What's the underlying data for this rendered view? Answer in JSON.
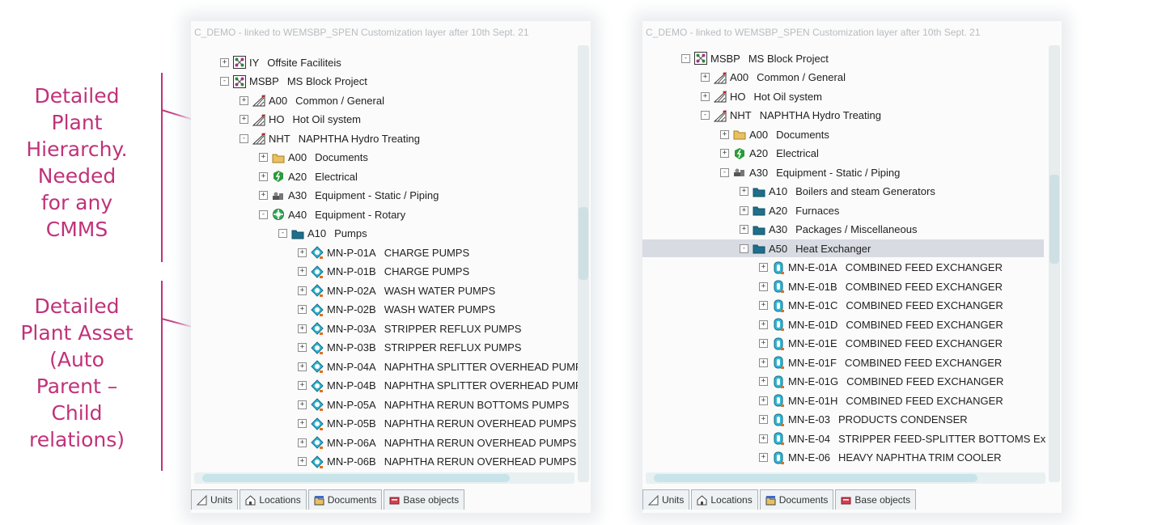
{
  "annotations": {
    "top": [
      "Detailed",
      "Plant",
      "Hierarchy.",
      "Needed",
      "for any",
      "CMMS"
    ],
    "bottom": [
      "Detailed",
      "Plant Asset",
      "(Auto",
      "Parent –",
      "Child",
      "relations)"
    ]
  },
  "colors": {
    "annotation": "#c0327a",
    "folder": "#1f6f8b",
    "pump": "#2fb8d8",
    "selected": "#d9dbe3"
  },
  "left_panel": {
    "header": "C_DEMO - linked to WEMSBP_SPEN  Customization layer after 10th Sept. 21",
    "rows": [
      {
        "exp": "+",
        "icon": "project-icon",
        "code": "IY",
        "name": "Offsite Faciliteis"
      },
      {
        "exp": "-",
        "icon": "project-icon",
        "code": "MSBP",
        "name": "MS Block Project"
      },
      {
        "exp": "+",
        "icon": "unit-icon",
        "code": "A00",
        "name": "Common / General"
      },
      {
        "exp": "+",
        "icon": "unit-icon",
        "code": "HO",
        "name": "Hot Oil system"
      },
      {
        "exp": "-",
        "icon": "unit-icon",
        "code": "NHT",
        "name": "NAPHTHA Hydro Treating"
      },
      {
        "exp": "+",
        "icon": "documents-folder-icon",
        "code": "A00",
        "name": "Documents"
      },
      {
        "exp": "+",
        "icon": "electrical-icon",
        "code": "A20",
        "name": "Electrical"
      },
      {
        "exp": "+",
        "icon": "static-equipment-icon",
        "code": "A30",
        "name": "Equipment - Static / Piping"
      },
      {
        "exp": "-",
        "icon": "rotary-equipment-icon",
        "code": "A40",
        "name": "Equipment - Rotary"
      },
      {
        "exp": "-",
        "icon": "folder-icon",
        "code": "A10",
        "name": "Pumps"
      },
      {
        "exp": "+",
        "icon": "pump-icon",
        "code": "MN-P-01A",
        "name": "CHARGE PUMPS"
      },
      {
        "exp": "+",
        "icon": "pump-icon",
        "code": "MN-P-01B",
        "name": "CHARGE PUMPS"
      },
      {
        "exp": "+",
        "icon": "pump-icon",
        "code": "MN-P-02A",
        "name": "WASH WATER PUMPS"
      },
      {
        "exp": "+",
        "icon": "pump-icon",
        "code": "MN-P-02B",
        "name": "WASH WATER PUMPS"
      },
      {
        "exp": "+",
        "icon": "pump-icon",
        "code": "MN-P-03A",
        "name": "STRIPPER REFLUX PUMPS"
      },
      {
        "exp": "+",
        "icon": "pump-icon",
        "code": "MN-P-03B",
        "name": "STRIPPER REFLUX PUMPS"
      },
      {
        "exp": "+",
        "icon": "pump-icon",
        "code": "MN-P-04A",
        "name": "NAPHTHA SPLITTER OVERHEAD PUMP"
      },
      {
        "exp": "+",
        "icon": "pump-icon",
        "code": "MN-P-04B",
        "name": "NAPHTHA SPLITTER OVERHEAD PUMP"
      },
      {
        "exp": "+",
        "icon": "pump-icon",
        "code": "MN-P-05A",
        "name": "NAPHTHA RERUN BOTTOMS PUMPS"
      },
      {
        "exp": "+",
        "icon": "pump-icon",
        "code": "MN-P-05B",
        "name": "NAPHTHA RERUN OVERHEAD PUMPS"
      },
      {
        "exp": "+",
        "icon": "pump-icon",
        "code": "MN-P-06A",
        "name": "NAPHTHA RERUN OVERHEAD PUMPS"
      },
      {
        "exp": "+",
        "icon": "pump-icon",
        "code": "MN-P-06B",
        "name": "NAPHTHA RERUN OVERHEAD PUMPS"
      }
    ],
    "tabs": [
      {
        "icon": "units-icon",
        "label": "Units"
      },
      {
        "icon": "locations-icon",
        "label": "Locations"
      },
      {
        "icon": "documents-icon",
        "label": "Documents"
      },
      {
        "icon": "base-objects-icon",
        "label": "Base objects"
      }
    ]
  },
  "right_panel": {
    "header": "C_DEMO - linked to WEMSBP_SPEN  Customization layer after 10th Sept. 21",
    "rows": [
      {
        "exp": "-",
        "icon": "project-icon",
        "code": "MSBP",
        "name": "MS Block Project"
      },
      {
        "exp": "+",
        "icon": "unit-icon",
        "code": "A00",
        "name": "Common / General"
      },
      {
        "exp": "+",
        "icon": "unit-icon",
        "code": "HO",
        "name": "Hot Oil system"
      },
      {
        "exp": "-",
        "icon": "unit-icon",
        "code": "NHT",
        "name": "NAPHTHA Hydro Treating"
      },
      {
        "exp": "+",
        "icon": "documents-folder-icon",
        "code": "A00",
        "name": "Documents"
      },
      {
        "exp": "+",
        "icon": "electrical-icon",
        "code": "A20",
        "name": "Electrical"
      },
      {
        "exp": "-",
        "icon": "static-equipment-icon",
        "code": "A30",
        "name": "Equipment - Static / Piping"
      },
      {
        "exp": "+",
        "icon": "folder-icon",
        "code": "A10",
        "name": "Boilers and steam Generators"
      },
      {
        "exp": "+",
        "icon": "folder-icon",
        "code": "A20",
        "name": "Furnaces"
      },
      {
        "exp": "+",
        "icon": "folder-icon",
        "code": "A30",
        "name": "Packages / Miscellaneous"
      },
      {
        "exp": "-",
        "icon": "folder-icon",
        "code": "A50",
        "name": "Heat Exchanger",
        "selected": true
      },
      {
        "exp": "+",
        "icon": "exchanger-icon",
        "code": "MN-E-01A",
        "name": "COMBINED FEED EXCHANGER"
      },
      {
        "exp": "+",
        "icon": "exchanger-icon",
        "code": "MN-E-01B",
        "name": "COMBINED FEED EXCHANGER"
      },
      {
        "exp": "+",
        "icon": "exchanger-icon",
        "code": "MN-E-01C",
        "name": "COMBINED FEED EXCHANGER"
      },
      {
        "exp": "+",
        "icon": "exchanger-icon",
        "code": "MN-E-01D",
        "name": "COMBINED FEED EXCHANGER"
      },
      {
        "exp": "+",
        "icon": "exchanger-icon",
        "code": "MN-E-01E",
        "name": "COMBINED FEED EXCHANGER"
      },
      {
        "exp": "+",
        "icon": "exchanger-icon",
        "code": "MN-E-01F",
        "name": "COMBINED FEED EXCHANGER"
      },
      {
        "exp": "+",
        "icon": "exchanger-icon",
        "code": "MN-E-01G",
        "name": "COMBINED FEED EXCHANGER"
      },
      {
        "exp": "+",
        "icon": "exchanger-icon",
        "code": "MN-E-01H",
        "name": "COMBINED FEED EXCHANGER"
      },
      {
        "exp": "+",
        "icon": "exchanger-icon",
        "code": "MN-E-03",
        "name": "PRODUCTS CONDENSER"
      },
      {
        "exp": "+",
        "icon": "exchanger-icon",
        "code": "MN-E-04",
        "name": "STRIPPER FEED-SPLITTER BOTTOMS Ex"
      },
      {
        "exp": "+",
        "icon": "exchanger-icon",
        "code": "MN-E-06",
        "name": "HEAVY NAPHTHA TRIM COOLER"
      }
    ],
    "tabs": [
      {
        "icon": "units-icon",
        "label": "Units"
      },
      {
        "icon": "locations-icon",
        "label": "Locations"
      },
      {
        "icon": "documents-icon",
        "label": "Documents"
      },
      {
        "icon": "base-objects-icon",
        "label": "Base objects"
      }
    ]
  }
}
